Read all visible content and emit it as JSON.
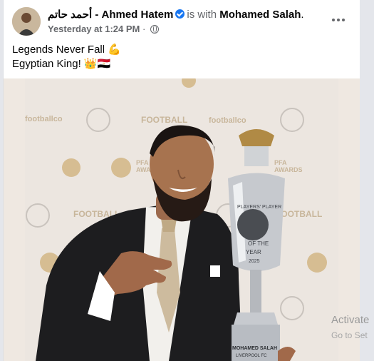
{
  "post": {
    "author_arabic": "أحمد حاتم",
    "separator": "-",
    "author_name": "Ahmed Hatem",
    "with_text": "is with",
    "tagged_name": "Mohamed Salah",
    "period": ".",
    "timestamp": "Yesterday at 1:24 PM",
    "dot": "·",
    "privacy_icon": "globe-icon",
    "more_icon": "more-options-icon",
    "text_line1": "Legends Never Fall 💪",
    "text_line2": "Egyptian King! 👑🇪🇬"
  },
  "photo": {
    "sponsor_text": "footballco",
    "brand_text": "FOOTBALL",
    "awards_text_1": "PFA",
    "awards_text_2": "AWARDS",
    "trophy_text_1": "PLAYERS' PLAYER",
    "trophy_text_2": "OF THE",
    "trophy_text_3": "YEAR",
    "trophy_year": "2025",
    "plaque_name": "MOHAMED SALAH",
    "plaque_club": "LIVERPOOL FC"
  },
  "overlay": {
    "activate_title": "Activate",
    "activate_sub": "Go to Set"
  },
  "colors": {
    "verified": "#1877f2",
    "text_primary": "#050505",
    "text_secondary": "#65676b"
  }
}
